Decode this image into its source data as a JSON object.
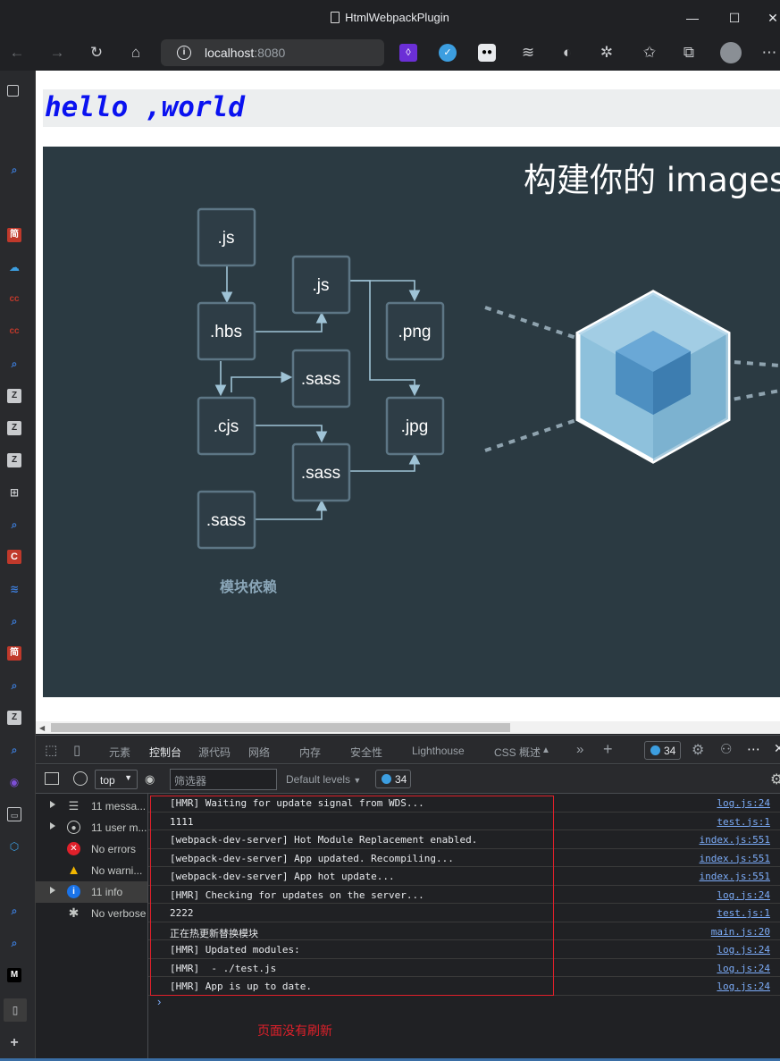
{
  "window": {
    "title": "HtmlWebpackPlugin"
  },
  "address": {
    "host": "localhost",
    "port": ":8080"
  },
  "page": {
    "heading": "hello ,world",
    "banner": {
      "title": "构建你的 images",
      "caption": "模块依赖",
      "nodes": [
        ".js",
        ".hbs",
        ".js",
        ".png",
        ".sass",
        ".cjs",
        ".jpg",
        ".sass",
        ".sass"
      ]
    }
  },
  "devtools": {
    "tabs": [
      "元素",
      "控制台",
      "源代码",
      "网络",
      "内存",
      "安全性",
      "Lighthouse",
      "CSS 概述"
    ],
    "active_tab": "控制台",
    "issues_count": "34",
    "context": "top",
    "filter_placeholder": "筛选器",
    "levels": "Default levels",
    "badge_count": "34",
    "sidebar": [
      {
        "label": "11 messa...",
        "icon": "list-icon"
      },
      {
        "label": "11 user m...",
        "icon": "user-icon"
      },
      {
        "label": "No errors",
        "icon": "error-icon"
      },
      {
        "label": "No warni...",
        "icon": "warning-icon"
      },
      {
        "label": "11 info",
        "icon": "info-icon"
      },
      {
        "label": "No verbose",
        "icon": "bug-icon"
      }
    ],
    "logs": [
      {
        "msg": "[HMR] Waiting for update signal from WDS...",
        "src": "log.js:24"
      },
      {
        "msg": "1111",
        "src": "test.js:1"
      },
      {
        "msg": "[webpack-dev-server] Hot Module Replacement enabled.",
        "src": "index.js:551"
      },
      {
        "msg": "[webpack-dev-server] App updated. Recompiling...",
        "src": "index.js:551"
      },
      {
        "msg": "[webpack-dev-server] App hot update...",
        "src": "index.js:551"
      },
      {
        "msg": "[HMR] Checking for updates on the server...",
        "src": "log.js:24"
      },
      {
        "msg": "2222",
        "src": "test.js:1"
      },
      {
        "msg": "正在热更新替换模块",
        "src": "main.js:20"
      },
      {
        "msg": "[HMR] Updated modules:",
        "src": "log.js:24"
      },
      {
        "msg": "[HMR]  - ./test.js",
        "src": "log.js:24"
      },
      {
        "msg": "[HMR] App is up to date.",
        "src": "log.js:24"
      }
    ],
    "annotation": "页面没有刷新"
  },
  "colors": {
    "heading": "#0a12f0",
    "annotation": "#e0202a",
    "banner_bg": "#2b3a42",
    "link": "#7cacf8"
  }
}
